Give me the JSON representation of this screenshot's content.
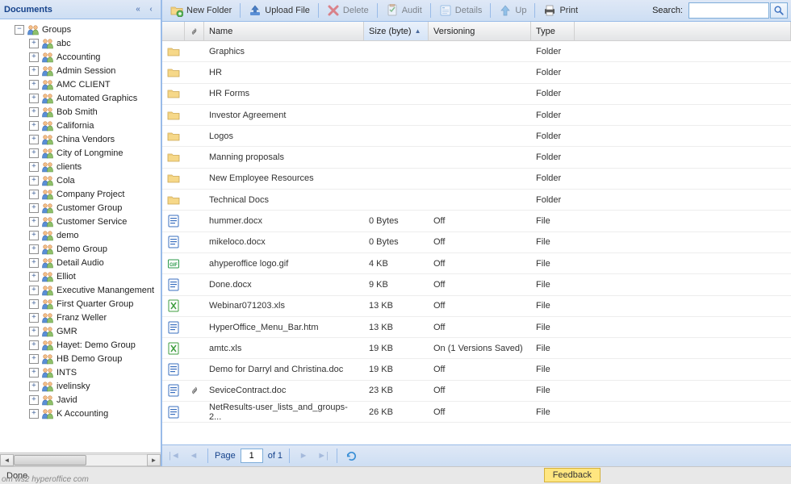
{
  "sidebar": {
    "title": "Documents",
    "root": {
      "label": "Groups",
      "expanded": true
    },
    "items": [
      {
        "label": "abc"
      },
      {
        "label": "Accounting"
      },
      {
        "label": "Admin Session"
      },
      {
        "label": "AMC CLIENT"
      },
      {
        "label": "Automated Graphics"
      },
      {
        "label": "Bob Smith"
      },
      {
        "label": "California"
      },
      {
        "label": "China Vendors"
      },
      {
        "label": "City of Longmine"
      },
      {
        "label": "clients"
      },
      {
        "label": "Cola"
      },
      {
        "label": "Company Project"
      },
      {
        "label": "Customer Group"
      },
      {
        "label": "Customer Service"
      },
      {
        "label": "demo"
      },
      {
        "label": "Demo Group"
      },
      {
        "label": "Detail Audio"
      },
      {
        "label": "Elliot"
      },
      {
        "label": "Executive Manangement"
      },
      {
        "label": "First Quarter Group"
      },
      {
        "label": "Franz Weller"
      },
      {
        "label": "GMR"
      },
      {
        "label": "Hayet: Demo Group"
      },
      {
        "label": "HB Demo Group"
      },
      {
        "label": "INTS"
      },
      {
        "label": "ivelinsky"
      },
      {
        "label": "Javid"
      },
      {
        "label": "K Accounting"
      }
    ]
  },
  "toolbar": {
    "new_folder": "New Folder",
    "upload_file": "Upload File",
    "delete": "Delete",
    "audit": "Audit",
    "details": "Details",
    "up": "Up",
    "print": "Print",
    "search_label": "Search:",
    "search_value": "",
    "search_placeholder": ""
  },
  "grid": {
    "columns": {
      "name": "Name",
      "size": "Size (byte)",
      "versioning": "Versioning",
      "type": "Type"
    },
    "sort": {
      "column": "size",
      "dir": "asc"
    },
    "rows": [
      {
        "icon": "folder",
        "name": "Graphics",
        "size": "",
        "ver": "",
        "type": "Folder",
        "attach": false
      },
      {
        "icon": "folder",
        "name": "HR",
        "size": "",
        "ver": "",
        "type": "Folder",
        "attach": false
      },
      {
        "icon": "folder",
        "name": "HR Forms",
        "size": "",
        "ver": "",
        "type": "Folder",
        "attach": false
      },
      {
        "icon": "folder",
        "name": "Investor Agreement",
        "size": "",
        "ver": "",
        "type": "Folder",
        "attach": false
      },
      {
        "icon": "folder",
        "name": "Logos",
        "size": "",
        "ver": "",
        "type": "Folder",
        "attach": false
      },
      {
        "icon": "folder",
        "name": "Manning proposals",
        "size": "",
        "ver": "",
        "type": "Folder",
        "attach": false
      },
      {
        "icon": "folder",
        "name": "New Employee Resources",
        "size": "",
        "ver": "",
        "type": "Folder",
        "attach": false
      },
      {
        "icon": "folder",
        "name": "Technical Docs",
        "size": "",
        "ver": "",
        "type": "Folder",
        "attach": false
      },
      {
        "icon": "word",
        "name": "hummer.docx",
        "size": "0 Bytes",
        "ver": "Off",
        "type": "File",
        "attach": false
      },
      {
        "icon": "word",
        "name": "mikeloco.docx",
        "size": "0 Bytes",
        "ver": "Off",
        "type": "File",
        "attach": false
      },
      {
        "icon": "gif",
        "name": "ahyperoffice logo.gif",
        "size": "4 KB",
        "ver": "Off",
        "type": "File",
        "attach": false
      },
      {
        "icon": "word",
        "name": "Done.docx",
        "size": "9 KB",
        "ver": "Off",
        "type": "File",
        "attach": false
      },
      {
        "icon": "excel",
        "name": "Webinar071203.xls",
        "size": "13 KB",
        "ver": "Off",
        "type": "File",
        "attach": false
      },
      {
        "icon": "word",
        "name": "HyperOffice_Menu_Bar.htm",
        "size": "13 KB",
        "ver": "Off",
        "type": "File",
        "attach": false
      },
      {
        "icon": "excel",
        "name": "amtc.xls",
        "size": "19 KB",
        "ver": "On (1 Versions Saved)",
        "type": "File",
        "attach": false
      },
      {
        "icon": "word",
        "name": "Demo for Darryl and Christina.doc",
        "size": "19 KB",
        "ver": "Off",
        "type": "File",
        "attach": false
      },
      {
        "icon": "word",
        "name": "SeviceContract.doc",
        "size": "23 KB",
        "ver": "Off",
        "type": "File",
        "attach": true
      },
      {
        "icon": "word",
        "name": "NetResults-user_lists_and_groups-2...",
        "size": "26 KB",
        "ver": "Off",
        "type": "File",
        "attach": false
      }
    ]
  },
  "paging": {
    "page_label": "Page",
    "page": "1",
    "of_label": "of 1"
  },
  "status": {
    "done": "Done",
    "feedback": "Feedback",
    "url": "om ws2 hyperoffice com"
  }
}
